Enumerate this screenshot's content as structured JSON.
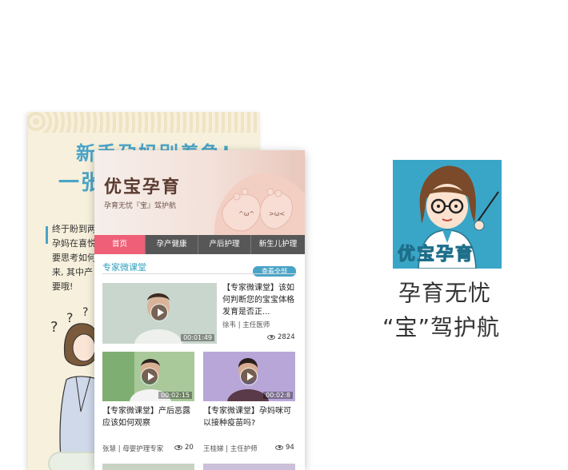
{
  "poster": {
    "headline_1": "新手孕妈别着急!",
    "headline_2": "一张图",
    "text_lines": [
      "终于盼到两",
      "孕妈在喜悦",
      "要思考如何",
      "来, 其中产",
      "要哦!"
    ]
  },
  "app": {
    "hero_title": "优宝孕育",
    "hero_subtitle": "孕育无忧『宝』驾护航"
  },
  "nav": {
    "items": [
      {
        "label": "首页",
        "active": true
      },
      {
        "label": "孕产健康",
        "active": false
      },
      {
        "label": "产后护理",
        "active": false
      },
      {
        "label": "新生儿护理",
        "active": false
      }
    ]
  },
  "section": {
    "title": "专家微课堂",
    "view_all": "查看全部"
  },
  "videos": [
    {
      "title": "【专家微课堂】该如何判断您的宝宝体格发育是否正...",
      "duration": "00:01:49",
      "meta": "徐韦 | 主任医师",
      "views": "2824"
    },
    {
      "title": "【专家微课堂】产后恶露应该如何观察",
      "duration": "00:02:15",
      "meta": "张慧 | 母婴护理专家",
      "views": "20"
    },
    {
      "title": "【专家微课堂】孕妈咪可以接种疫苗吗?",
      "duration": "00:02:8",
      "meta": "王桂娣 | 主任护师",
      "views": "94"
    }
  ],
  "icon": {
    "label": "优宝孕育"
  },
  "slogan": {
    "line_1": "孕育无忧",
    "line_2": "“宝”驾护航"
  },
  "colors": {
    "accent_blue": "#4aa4c8",
    "active_pink": "#ef5f77",
    "nav_gray": "#575757",
    "icon_bg": "#3aa6c7"
  }
}
